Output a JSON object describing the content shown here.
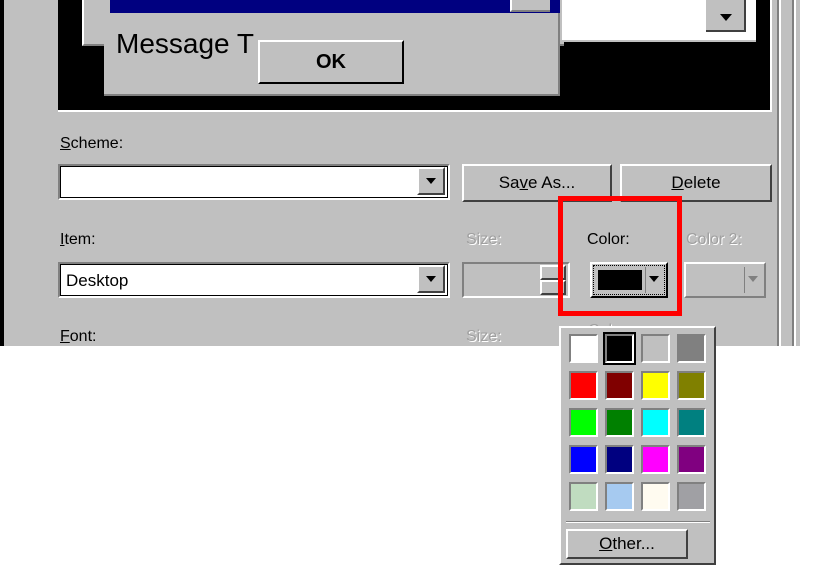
{
  "preview": {
    "message_text": "Message T",
    "ok_label": "OK"
  },
  "scheme": {
    "label": "Scheme:",
    "accel": "S",
    "label_rest": "cheme:",
    "value": "",
    "save_as_label": "Save As...",
    "save_as_accel": "v",
    "delete_label": "Delete",
    "delete_accel": "D"
  },
  "item": {
    "label_accel": "I",
    "label_rest": "tem:",
    "value": "Desktop",
    "size_label": "Size:",
    "color_label": "Color:",
    "color2_label": "Color 2:",
    "current_color": "#000000"
  },
  "font": {
    "label_accel": "F",
    "label_rest": "ont:",
    "size_label": "Size:",
    "color_label_fragment": "Col"
  },
  "color_picker": {
    "swatches": [
      [
        "#ffffff",
        "#000000",
        "#c0c0c0",
        "#808080"
      ],
      [
        "#ff0000",
        "#800000",
        "#ffff00",
        "#808000"
      ],
      [
        "#00ff00",
        "#008000",
        "#00ffff",
        "#008080"
      ],
      [
        "#0000ff",
        "#000080",
        "#ff00ff",
        "#800080"
      ],
      [
        "#c0dcc0",
        "#a6caf0",
        "#fffbf0",
        "#a0a0a4"
      ]
    ],
    "selected": "#000000",
    "other_accel": "O",
    "other_label_rest": "ther..."
  },
  "colors": {
    "face": "#c0c0c0",
    "titlebar": "#000080",
    "highlight": "#ff0000"
  }
}
